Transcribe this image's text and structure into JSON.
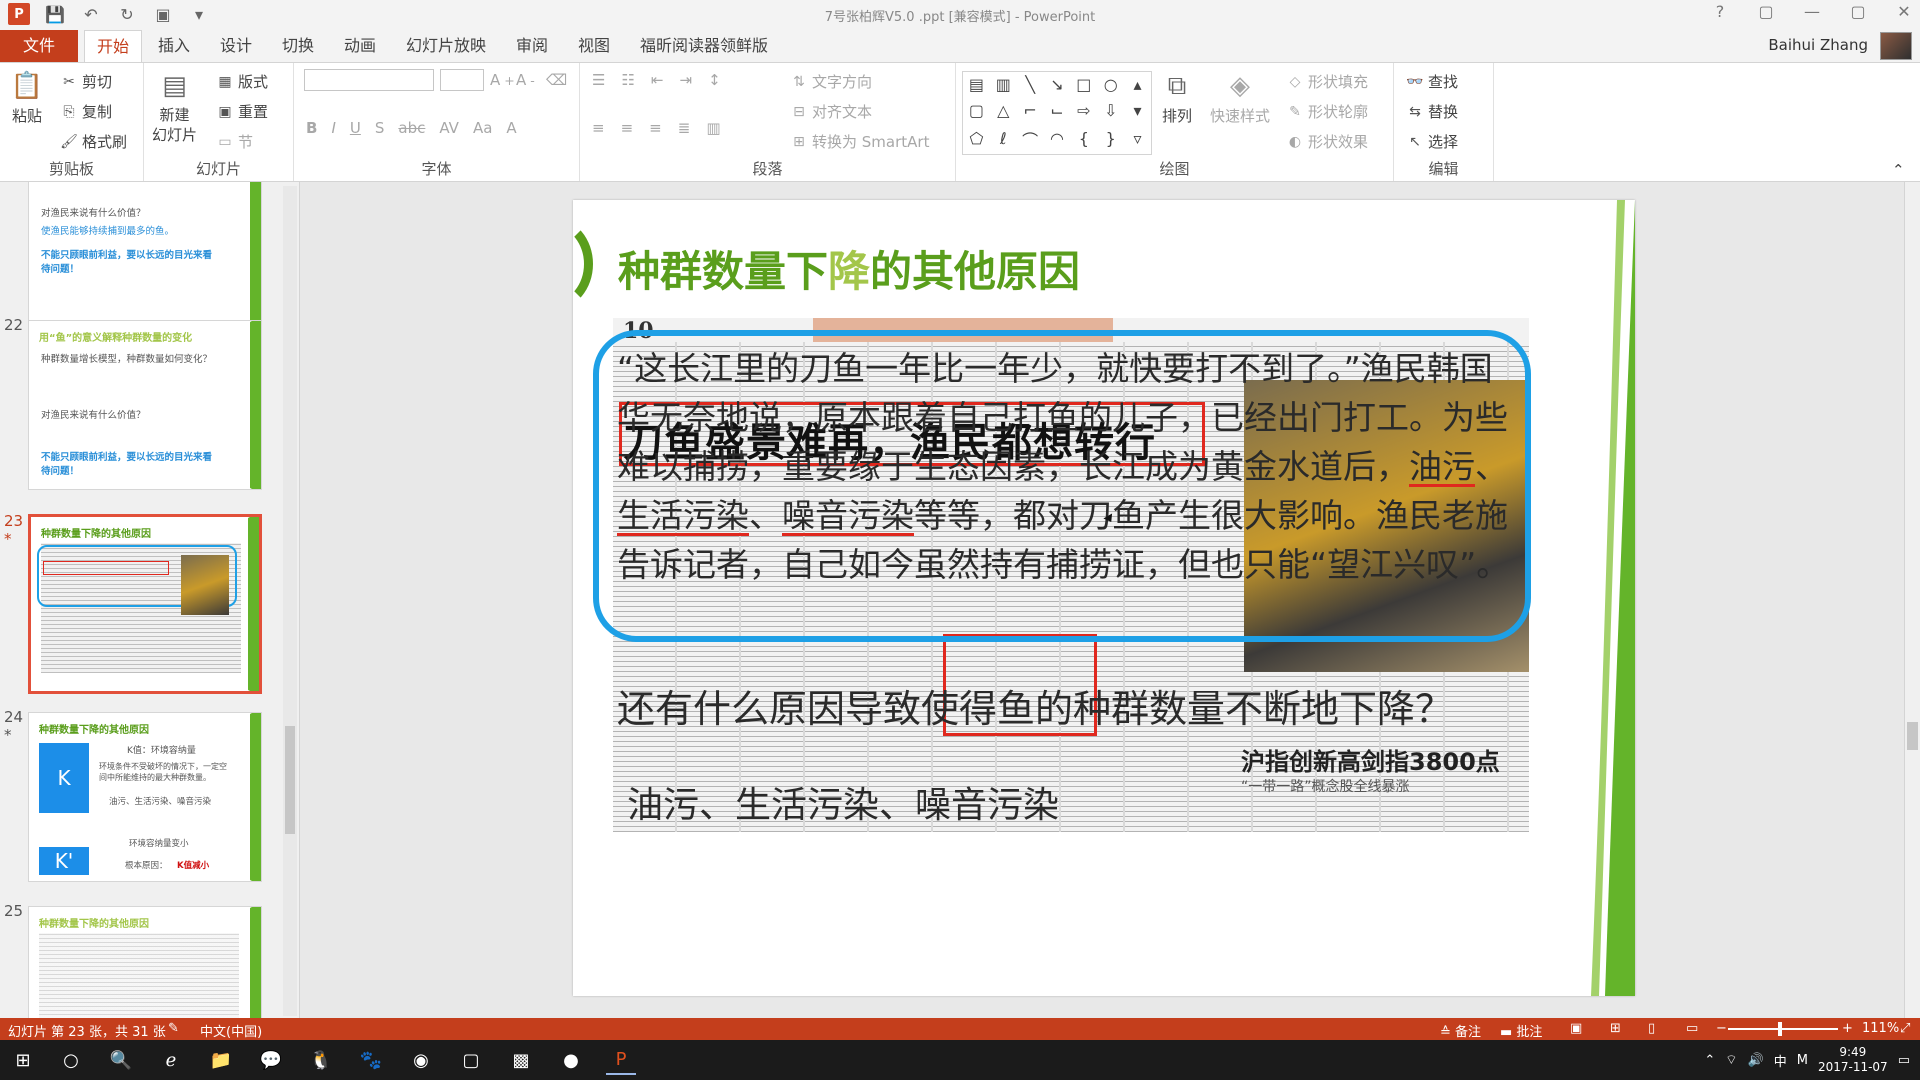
{
  "window": {
    "title": "7号张柏辉V5.0 .ppt [兼容模式] - PowerPoint",
    "user": "Baihui Zhang",
    "controls": [
      "?",
      "▢",
      "—",
      "▢",
      "✕"
    ]
  },
  "ribbon_tabs": [
    "文件",
    "开始",
    "插入",
    "设计",
    "切换",
    "动画",
    "幻灯片放映",
    "审阅",
    "视图",
    "福昕阅读器领鲜版"
  ],
  "ribbon": {
    "clipboard": {
      "label": "剪贴板",
      "paste": "粘贴",
      "cut": "剪切",
      "copy": "复制",
      "format_painter": "格式刷"
    },
    "slides": {
      "label": "幻灯片",
      "new_slide": "新建\n幻灯片",
      "layout": "版式",
      "reset": "重置",
      "section": "节"
    },
    "font": {
      "label": "字体"
    },
    "paragraph": {
      "label": "段落",
      "text_direction": "文字方向",
      "align_text": "对齐文本",
      "smartart": "转换为 SmartArt"
    },
    "drawing": {
      "label": "绘图",
      "arrange": "排列",
      "quick_styles": "快速样式",
      "shape_fill": "形状填充",
      "shape_outline": "形状轮廓",
      "shape_effects": "形状效果"
    },
    "editing": {
      "label": "编辑",
      "find": "查找",
      "replace": "替换",
      "select": "选择"
    }
  },
  "thumbnails": [
    {
      "num": "",
      "lines": [
        "对渔民来说有什么价值？",
        "使渔民能够持续捕到最多的鱼。",
        "不能只顾眼前利益，要以长远的目光来看待问题！"
      ]
    },
    {
      "num": "22",
      "title": "用“鱼”的意义解释种群数量的变化",
      "lines": [
        "种群数量增长模型，种群数量如何变化？",
        "对渔民来说有什么价值？",
        "不能只顾眼前利益，要以长远的目光来看待问题！"
      ]
    },
    {
      "num": "23",
      "title": "种群数量下降的其他原因",
      "selected": true
    },
    {
      "num": "24",
      "title": "种群数量下降的其他原因",
      "k_label": "K值：环境容纳量",
      "k_desc": "环境条件不受破坏的情况下，一定空间中所能维持的最大种群数量。",
      "k_factors": "油污、生活污染、噪音污染",
      "k_small": "环境容纳量变小",
      "k_root": "根本原因：",
      "k_red": "K值减小"
    },
    {
      "num": "25",
      "title": "种群数量下降的其他原因"
    }
  ],
  "slide": {
    "title_a": "种群数量下",
    "title_hl": "降",
    "title_b": "的其他原因",
    "newspaper": {
      "page_num": "10",
      "headline": "刀鱼盛景难再，渔民都想转行",
      "headline2": "沪指创新高剑指3800点",
      "sub2": "“一带一路”概念股全线暴涨"
    },
    "para_1": "“这长江里的刀鱼一年比一年少，就快要打不到了。”渔民韩国华无奈地说，原本跟着自己打鱼的儿子，已经出门打工。为些难以捕捞，重要缘于生态因素，长江成为黄金水道后，",
    "u_1": "油污",
    "sep_1": "、",
    "u_2": "生活污染",
    "sep_2": "、",
    "u_3": "噪音污染",
    "para_2": "等等，都对刀鱼产生很大影响。渔民老施告诉记者，自己如今虽然持有捕捞证，但也只能“望江兴叹”。",
    "question": "还有什么原因导致使得鱼的种群数量不断地下降？",
    "answer": "油污、生活污染、噪音污染"
  },
  "status": {
    "slide_info": "幻灯片 第 23 张，共 31 张",
    "language": "中文(中国)",
    "notes": "备注",
    "comments": "批注",
    "zoom": "111%"
  },
  "taskbar": {
    "time": "9:49",
    "date": "2017-11-07",
    "ime": "中"
  },
  "colors": {
    "accent": "#c43e1c",
    "title_green": "#5a9e1c",
    "frame_blue": "#1ea0e6",
    "box_red": "#e0281e"
  }
}
